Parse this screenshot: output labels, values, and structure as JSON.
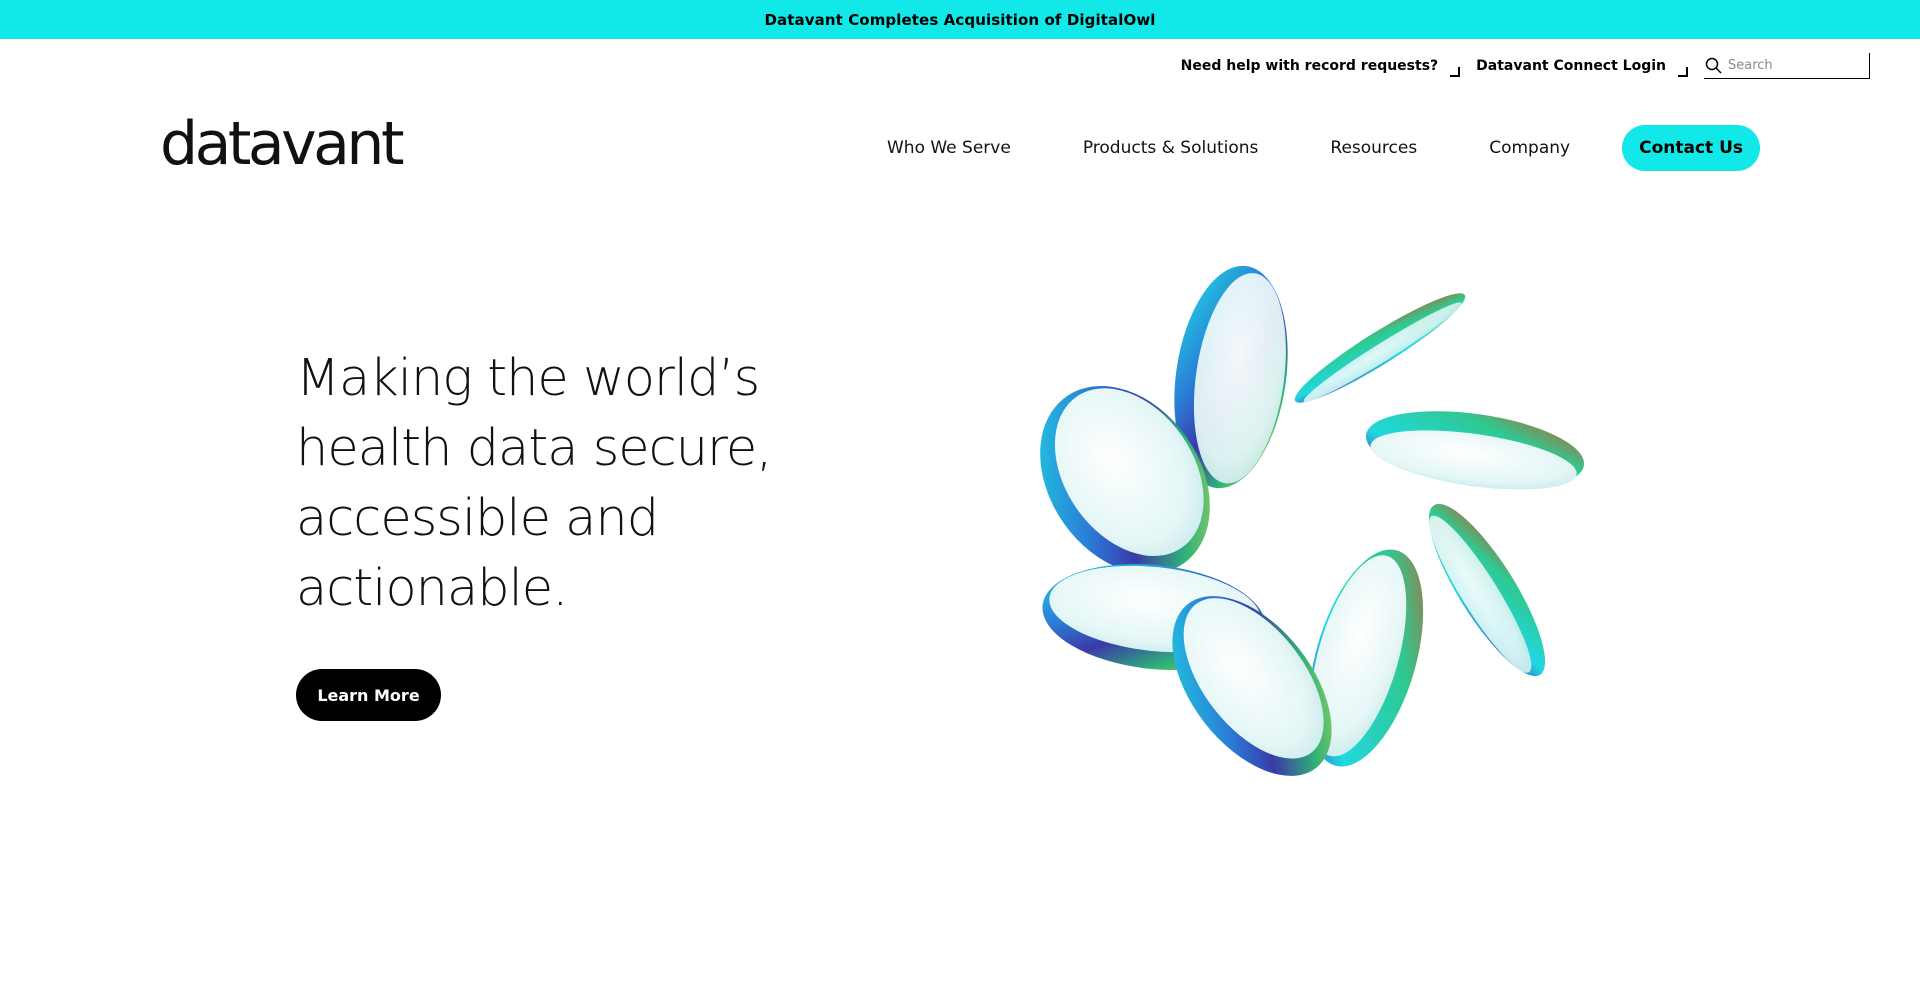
{
  "announcement": {
    "text": "Datavant Completes Acquisition of DigitalOwl"
  },
  "utility": {
    "record_requests": "Need help with record requests?",
    "connect_login": "Datavant Connect Login",
    "search_placeholder": "Search"
  },
  "brand": {
    "logo_text": "datavant"
  },
  "nav": {
    "items": [
      {
        "label": "Who We Serve"
      },
      {
        "label": "Products & Solutions"
      },
      {
        "label": "Resources"
      },
      {
        "label": "Company"
      }
    ],
    "contact_label": "Contact Us"
  },
  "hero": {
    "heading_lines": [
      "Making the world’s",
      "health data secure,",
      "accessible and",
      "actionable."
    ],
    "cta_label": "Learn More"
  },
  "colors": {
    "accent": "#12e8e8",
    "button_dark": "#000000",
    "text": "#111111"
  },
  "icons": [
    "search-icon",
    "external-link-icon",
    "glass-disc-art"
  ]
}
